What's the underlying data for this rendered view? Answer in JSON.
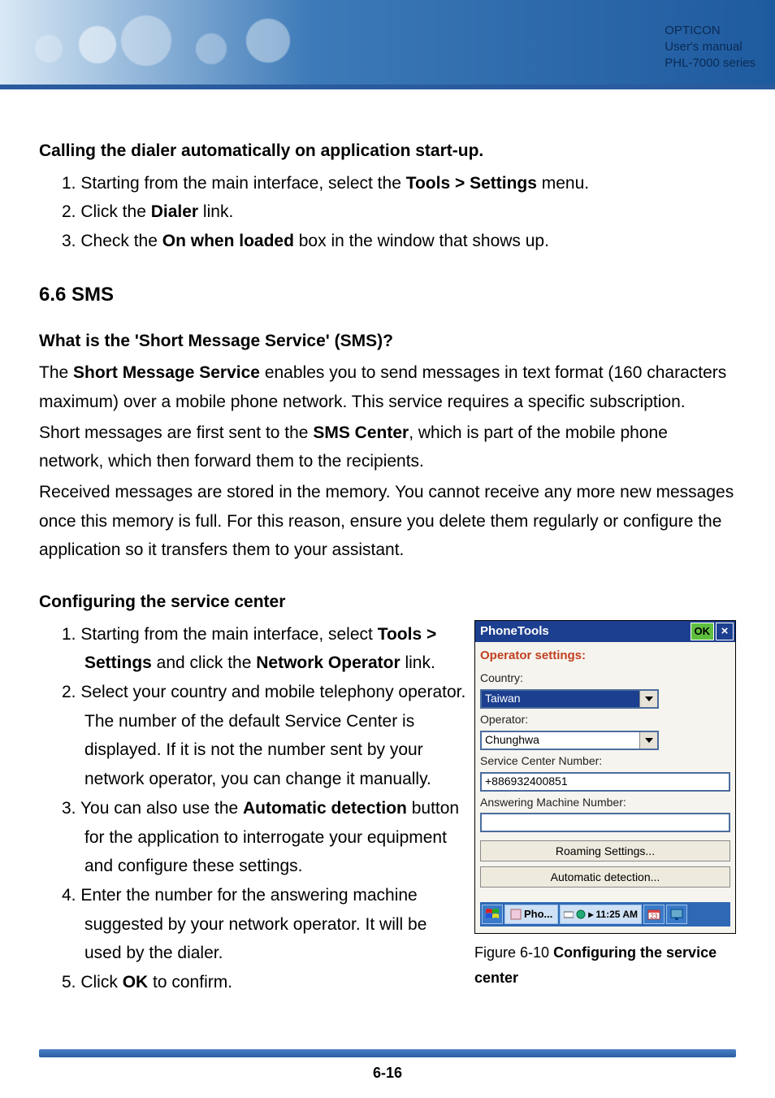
{
  "header": {
    "brand": "OPTICON",
    "line2": "User's manual",
    "line3": "PHL-7000 series"
  },
  "sections": {
    "dialer": {
      "title": "Calling the dialer automatically on application start-up",
      "steps": [
        {
          "pre": "1. Starting from the main interface, select the ",
          "bold": "Tools > Settings",
          "post": " menu."
        },
        {
          "pre": "2. Click the ",
          "bold": "Dialer",
          "post": " link."
        },
        {
          "pre": "3. Check the ",
          "bold": "On when loaded",
          "post": " box in the window that shows up."
        }
      ]
    },
    "sms": {
      "heading": "6.6 SMS",
      "q_title": "What is the 'Short Message Service' (SMS)?",
      "p1_pre": "The ",
      "p1_bold": "Short Message Service",
      "p1_post": " enables you to send messages in text format (160 characters maximum) over a mobile phone network. This service requires a specific subscription.",
      "p2_pre": "Short messages are first sent to the ",
      "p2_bold": "SMS Center",
      "p2_post": ", which is part of the mobile phone network, which then forward them to the recipients.",
      "p3": "Received messages are stored in the memory. You cannot receive any more new messages once this memory is full. For this reason, ensure you delete them regularly or configure the application so it transfers them to your assistant."
    },
    "config": {
      "title": "Configuring the service center",
      "s1_pre": "1. Starting from the main interface, select ",
      "s1_bold1": "Tools > Settings",
      "s1_mid": " and click the ",
      "s1_bold2": "Network Operator",
      "s1_post": " link.",
      "s2": "2. Select your country and mobile telephony operator. The number of the default Service Center is displayed. If it is not the number sent by your network operator, you can change it manually.",
      "s3_pre": "3. You can also use the ",
      "s3_bold": "Automatic detection",
      "s3_post": " button for the application to interrogate your equipment and configure these settings.",
      "s4": "4. Enter the number for the answering machine suggested by your network operator. It will be used by the dialer.",
      "s5_pre": "5. Click ",
      "s5_bold": "OK",
      "s5_post": " to confirm."
    }
  },
  "phone": {
    "title": "PhoneTools",
    "ok": "OK",
    "close": "×",
    "op_settings": "Operator settings:",
    "country_label": "Country:",
    "country_value": "Taiwan",
    "operator_label": "Operator:",
    "operator_value": "Chunghwa",
    "scn_label": "Service Center Number:",
    "scn_value": "+886932400851",
    "amn_label": "Answering Machine Number:",
    "amn_value": "",
    "roaming_btn": "Roaming Settings...",
    "auto_btn": "Automatic detection...",
    "task_name": "Pho...",
    "time": "11:25 AM"
  },
  "caption": {
    "pre": "Figure 6-10 ",
    "bold": "Configuring the service center"
  },
  "page_number": "6-16"
}
